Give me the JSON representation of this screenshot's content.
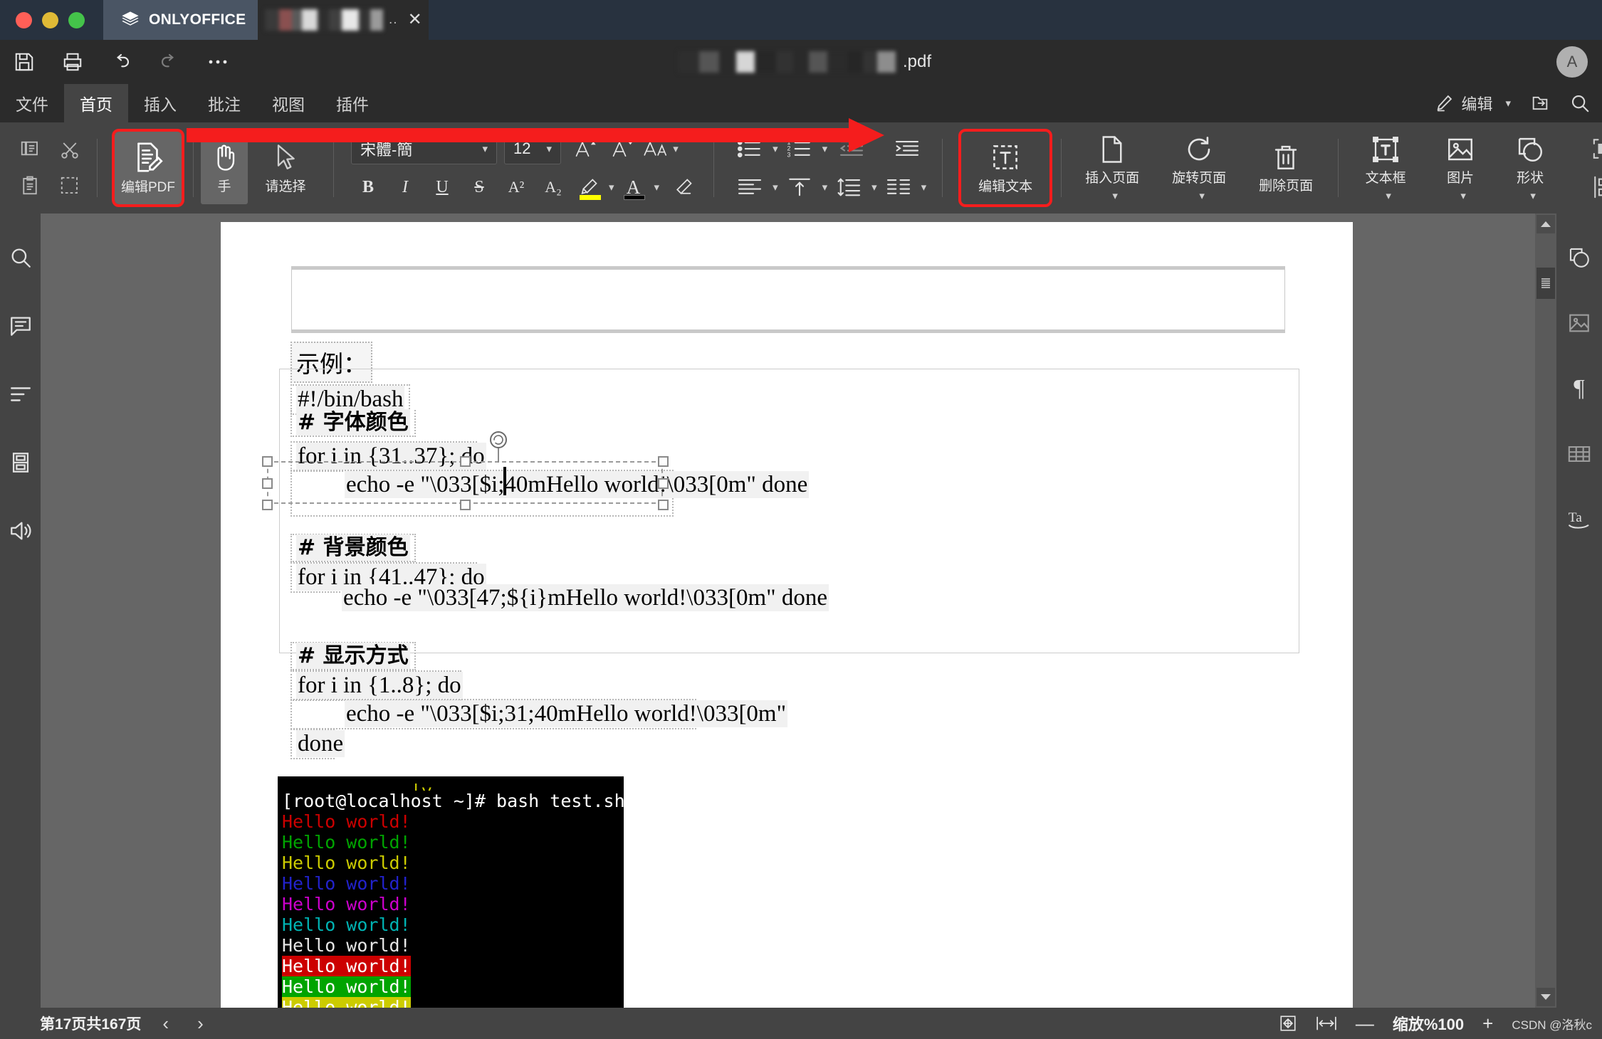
{
  "titlebar": {
    "app_name": "ONLYOFFICE",
    "logo_icon": "layers-icon",
    "doc_tab_ellipsis": "..",
    "close_label": "✕",
    "window_buttons": [
      "close-red",
      "minimize-yellow",
      "maximize-green"
    ]
  },
  "quickaccess": {
    "save_icon": "save-icon",
    "print_icon": "print-icon",
    "undo_icon": "undo-icon",
    "redo_icon": "redo-icon",
    "more_icon": "ellipsis-icon",
    "doc_title_suffix": ".pdf",
    "avatar_initial": "A"
  },
  "menu": {
    "tabs": [
      {
        "label": "文件",
        "active": false
      },
      {
        "label": "首页",
        "active": true
      },
      {
        "label": "插入",
        "active": false
      },
      {
        "label": "批注",
        "active": false
      },
      {
        "label": "视图",
        "active": false
      },
      {
        "label": "插件",
        "active": false
      }
    ],
    "edit_mode_label": "编辑",
    "edit_icon": "pencil-icon",
    "open_location_icon": "open-folder-icon",
    "search_icon": "search-icon"
  },
  "ribbon": {
    "copy_icon": "copy-icon",
    "cut_icon": "scissors-icon",
    "paste_icon": "paste-icon",
    "select_all_icon": "select-area-icon",
    "edit_pdf": {
      "label": "编辑PDF",
      "icon": "document-pencil-icon",
      "highlighted": true,
      "selected": true
    },
    "hand_tool": {
      "label": "手",
      "icon": "hand-icon",
      "selected": true
    },
    "select_tool": {
      "label": "请选择",
      "icon": "cursor-arrow-icon"
    },
    "font_family": "宋體-簡",
    "font_size": "12",
    "increase_font_icon": "increase-font-icon",
    "decrease_font_icon": "decrease-font-icon",
    "change_case_icon": "change-case-icon",
    "bold": "B",
    "italic": "I",
    "underline": "U",
    "strikethrough": "S",
    "superscript": "A²",
    "subscript": "A₂",
    "highlight_icon": "highlight-pen-icon",
    "highlight_color": "#ffff00",
    "font_color_icon": "font-color-icon",
    "font_color": "#000000",
    "clear_format_icon": "clear-format-icon",
    "bullet_list_icon": "bullet-list-icon",
    "numbered_list_icon": "numbered-list-icon",
    "decrease_indent_icon": "decrease-indent-icon",
    "increase_indent_icon": "increase-indent-icon",
    "align_icon": "align-left-icon",
    "vertical_align_icon": "vertical-align-top-icon",
    "line_spacing_icon": "line-spacing-icon",
    "columns_icon": "columns-icon",
    "edit_text": {
      "label": "编辑文本",
      "icon": "text-edit-icon",
      "highlighted": true
    },
    "insert_page": {
      "label": "插入页面",
      "icon": "page-icon"
    },
    "rotate_page": {
      "label": "旋转页面",
      "icon": "rotate-icon"
    },
    "delete_page": {
      "label": "删除页面",
      "icon": "trash-icon"
    },
    "text_box": {
      "label": "文本框",
      "icon": "textbox-icon"
    },
    "image": {
      "label": "图片",
      "icon": "image-icon"
    },
    "shape": {
      "label": "形状",
      "icon": "shape-icon"
    },
    "arrange_icon": "arrange-objects-icon",
    "align_objects_icon": "align-objects-icon",
    "annotation_arrow_color": "#f51d1d"
  },
  "left_sidebar": {
    "items": [
      {
        "icon": "search-icon",
        "name": "search"
      },
      {
        "icon": "comment-icon",
        "name": "comments"
      },
      {
        "icon": "headings-icon",
        "name": "headings"
      },
      {
        "icon": "page-thumbnails-icon",
        "name": "thumbnails"
      },
      {
        "icon": "feedback-megaphone-icon",
        "name": "feedback"
      }
    ]
  },
  "right_sidebar": {
    "items": [
      {
        "icon": "shape-settings-icon",
        "name": "shape-settings"
      },
      {
        "icon": "image-settings-icon",
        "name": "image-settings"
      },
      {
        "icon": "paragraph-settings-icon",
        "name": "paragraph-settings"
      },
      {
        "icon": "table-settings-icon",
        "name": "table-settings"
      },
      {
        "icon": "text-art-icon",
        "name": "text-art-settings"
      }
    ]
  },
  "document": {
    "example_label": "示例：",
    "code_lines": [
      "#!/bin/bash",
      "# 字体颜色",
      "for i in {31..37}; do",
      "echo -e \"\\033[$i;40mHello world!\\033[0m\" done",
      "# 背景颜色",
      "for i in {41..47}; do",
      "echo -e \"\\033[47;${i}mHello world!\\033[0m\" done",
      "# 显示方式",
      "for i in {1..8}; do",
      "echo -e \"\\033[$i;31;40mHello world!\\033[0m\"",
      "done"
    ],
    "selected_textbox_text": "echo -e \"\\033[47;${i}mHello world!\\033[0m\" done",
    "terminal": {
      "prompt_line": "[root@localhost ~]# bash test.sh",
      "lines": [
        {
          "text": "Hello world!",
          "fg": "#cc0000",
          "bg": "#000000"
        },
        {
          "text": "Hello world!",
          "fg": "#00a400",
          "bg": "#000000"
        },
        {
          "text": "Hello world!",
          "fg": "#cccc00",
          "bg": "#000000"
        },
        {
          "text": "Hello world!",
          "fg": "#2222cc",
          "bg": "#000000"
        },
        {
          "text": "Hello world!",
          "fg": "#cc00cc",
          "bg": "#000000"
        },
        {
          "text": "Hello world!",
          "fg": "#00b3b3",
          "bg": "#000000"
        },
        {
          "text": "Hello world!",
          "fg": "#e6e6e6",
          "bg": "#000000"
        },
        {
          "text": "Hello world!",
          "fg": "#ffffff",
          "bg": "#cc0000"
        },
        {
          "text": "Hello world!",
          "fg": "#ffffff",
          "bg": "#00a400"
        },
        {
          "text": "Hello world!",
          "fg": "#ffffff",
          "bg": "#cccc00"
        }
      ]
    }
  },
  "status_bar": {
    "page_indicator": "第17页共167页",
    "prev_icon": "chevron-left-icon",
    "next_icon": "chevron-right-icon",
    "fit_page_icon": "fit-page-icon",
    "fit_width_icon": "fit-width-icon",
    "zoom_out": "—",
    "zoom_label": "缩放%100",
    "zoom_in": "+",
    "watermark": "CSDN @洛秋c"
  }
}
